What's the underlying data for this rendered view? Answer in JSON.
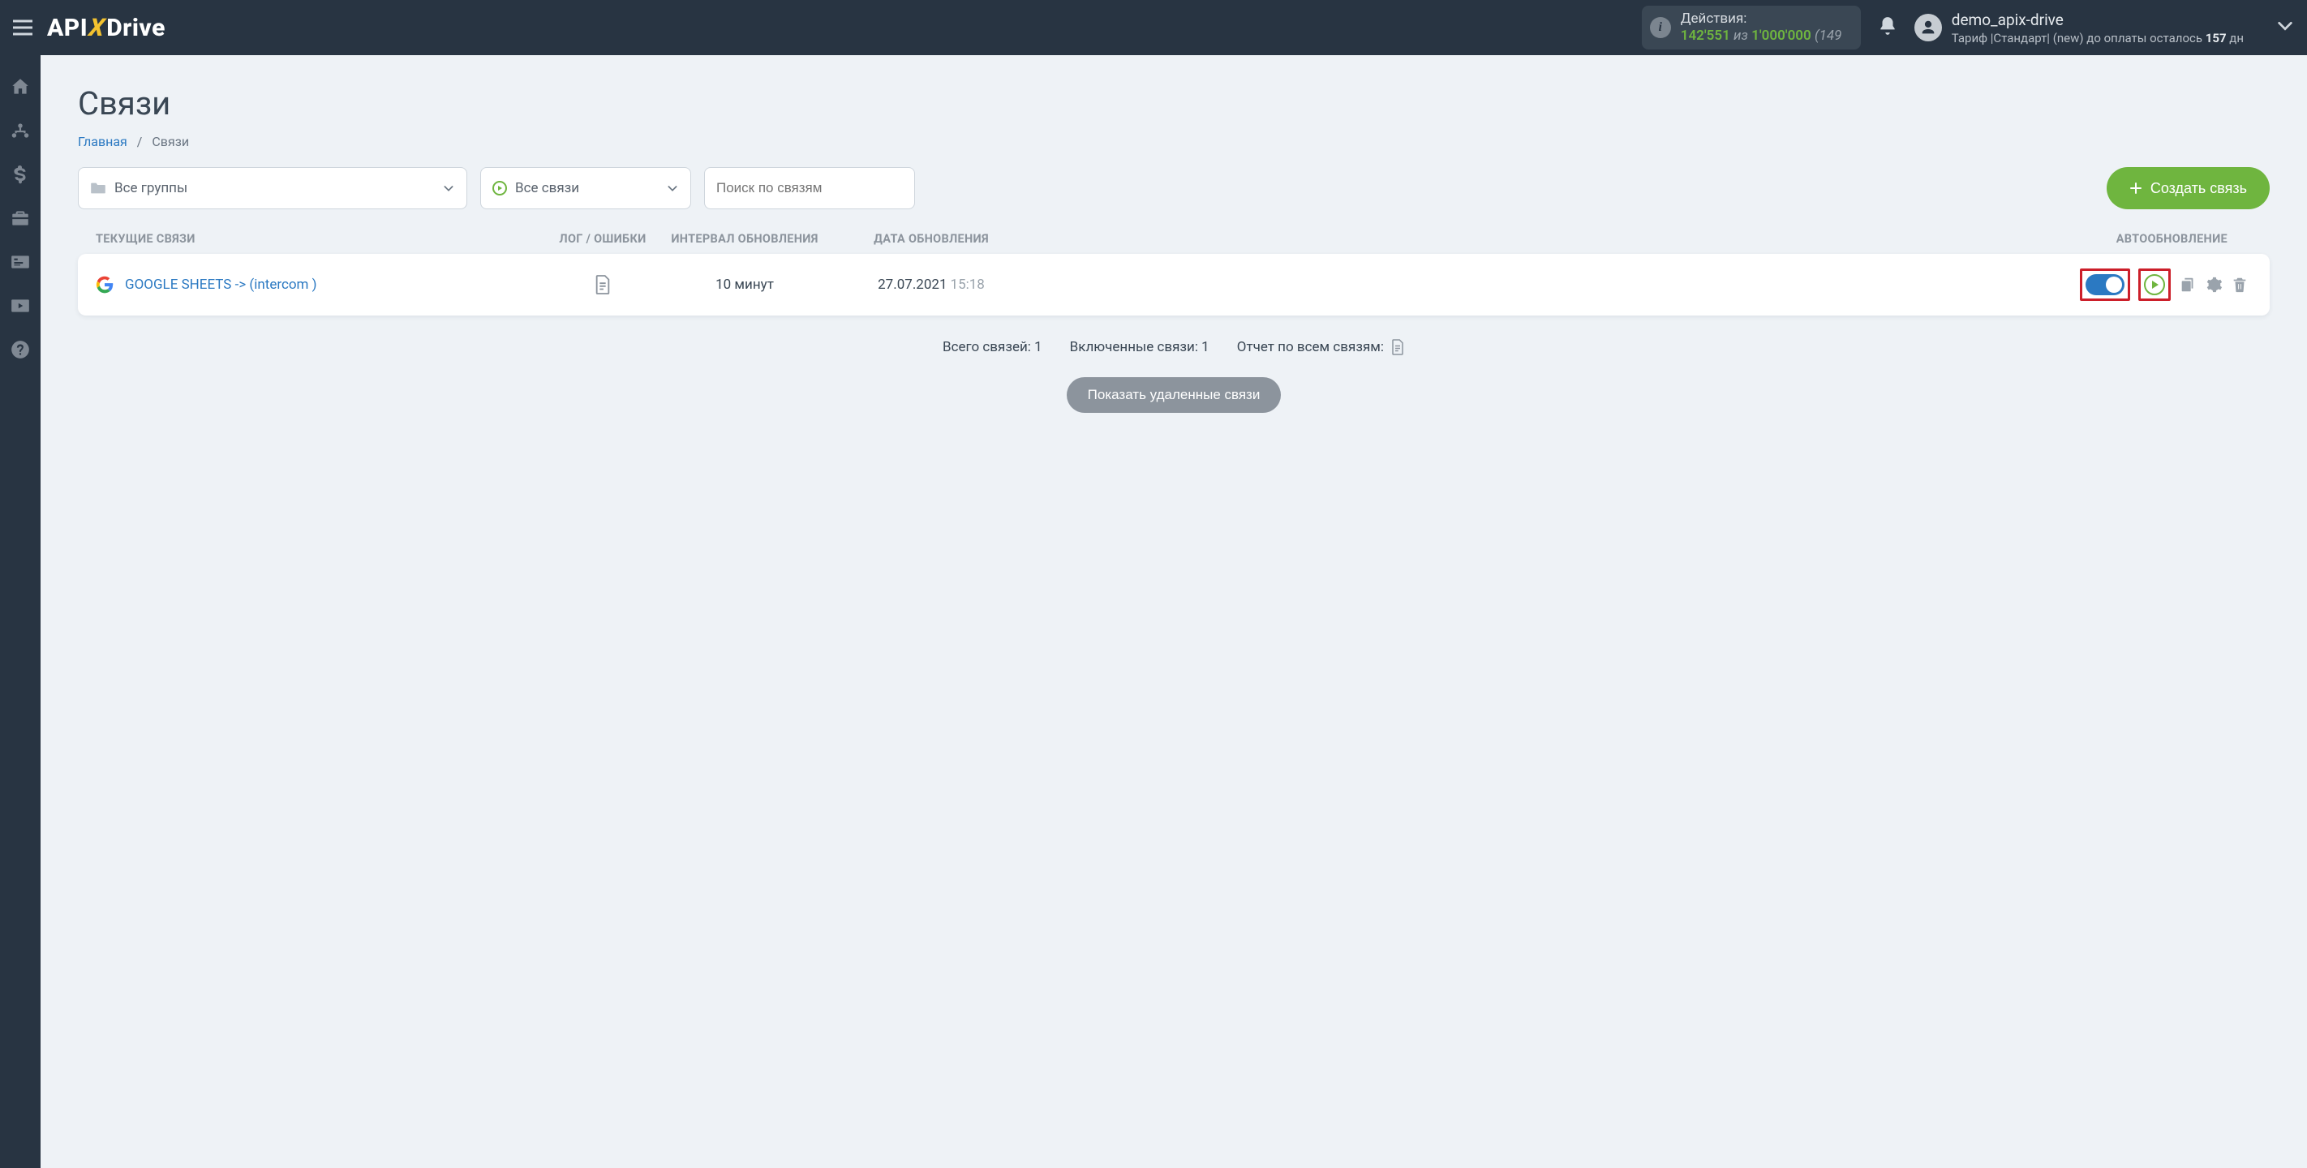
{
  "header": {
    "actions_label": "Действия:",
    "actions_used": "142'551",
    "actions_of": "из",
    "actions_total": "1'000'000",
    "actions_tail": "(149",
    "user_name": "demo_apix-drive",
    "tariff_prefix": "Тариф |Стандарт| (new) до оплаты осталось ",
    "tariff_days": "157",
    "tariff_suffix": " дн"
  },
  "page": {
    "title": "Связи",
    "crumb_home": "Главная",
    "crumb_sep": "/",
    "crumb_current": "Связи"
  },
  "toolbar": {
    "group_select": "Все группы",
    "all_select": "Все связи",
    "search_placeholder": "Поиск по связям",
    "create_label": "Создать связь"
  },
  "columns": {
    "name": "ТЕКУЩИЕ СВЯЗИ",
    "log": "ЛОГ / ОШИБКИ",
    "interval": "ИНТЕРВАЛ ОБНОВЛЕНИЯ",
    "date": "ДАТА ОБНОВЛЕНИЯ",
    "auto": "АВТООБНОВЛЕНИЕ"
  },
  "rows": [
    {
      "name": "GOOGLE SHEETS -> (intercom )",
      "interval": "10 минут",
      "date": "27.07.2021",
      "time": "15:18",
      "enabled": true
    }
  ],
  "footer": {
    "total_label": "Всего связей: 1",
    "enabled_label": "Включенные связи: 1",
    "report_label": "Отчет по всем связям:",
    "show_deleted": "Показать удаленные связи"
  },
  "icons": {
    "info": "i"
  }
}
